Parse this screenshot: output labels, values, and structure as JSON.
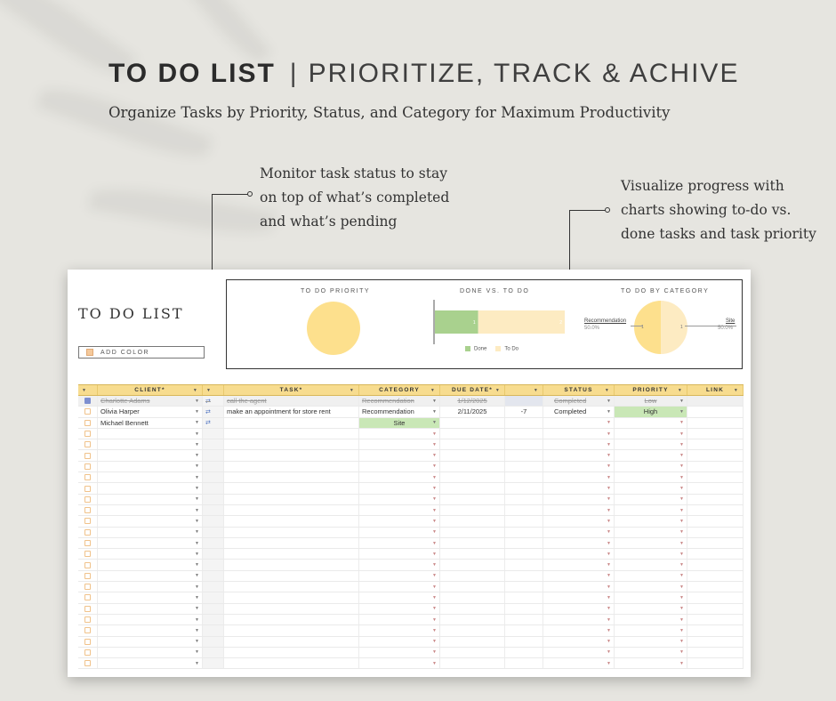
{
  "hero": {
    "title_strong": "TO DO LIST",
    "separator": "|",
    "title_rest": "PRIORITIZE, TRACK & ACHIVE",
    "subtitle": "Organize Tasks by Priority, Status, and Category for Maximum Productivity"
  },
  "callouts": {
    "status": [
      "Monitor task status to stay",
      "on top of what’s completed",
      "and what’s pending"
    ],
    "charts": [
      "Visualize progress with",
      "charts showing to-do vs.",
      "done tasks and task priority"
    ]
  },
  "sheet": {
    "title": "TO DO LIST",
    "add_color_label": "ADD COLOR",
    "charts": {
      "priority_title": "TO DO PRIORITY",
      "done_title": "DONE VS. TO DO",
      "category_title": "TO DO BY CATEGORY",
      "legend_done": "Done",
      "legend_todo": "To Do",
      "bar_done_label": "1",
      "bar_todo_label": "2",
      "cat_left_label": "Recommendation",
      "cat_left_pct": "50.0%",
      "cat_right_label": "Site",
      "cat_right_pct": "50.0%",
      "cat_left_count": "1",
      "cat_right_count": "1"
    },
    "colors": {
      "header": "#f7dc8f",
      "done_bar": "#a9d18e",
      "todo_bar": "#fdebc2",
      "pie": "#fde08d",
      "green_cell": "#c9e7b6"
    },
    "columns": [
      "CLIENT*",
      "TASK*",
      "CATEGORY",
      "DUE DATE*",
      "STATUS",
      "PRIORITY",
      "LINK"
    ],
    "rows": [
      {
        "done": true,
        "client": "Charlotte Adams",
        "task": "call the agent",
        "category": "Recommendation",
        "due": "1/12/2025",
        "days": "",
        "status": "Completed",
        "priority": "Low",
        "link": ""
      },
      {
        "done": false,
        "client": "Olivia Harper",
        "task": "make an appointment for store rent",
        "category": "Recommendation",
        "due": "2/11/2025",
        "days": "-7",
        "status": "Completed",
        "priority": "High",
        "link": ""
      },
      {
        "done": false,
        "client": "Michael Bennett",
        "task": "",
        "category": "Site",
        "due": "",
        "days": "",
        "status": "",
        "priority": "",
        "link": ""
      }
    ]
  },
  "chart_data": [
    {
      "type": "pie",
      "title": "TO DO PRIORITY",
      "categories": [
        ""
      ],
      "values": [
        1
      ]
    },
    {
      "type": "bar",
      "title": "DONE VS. TO DO",
      "categories": [
        "Done",
        "To Do"
      ],
      "values": [
        1,
        2
      ]
    },
    {
      "type": "pie",
      "title": "TO DO BY CATEGORY",
      "categories": [
        "Recommendation",
        "Site"
      ],
      "values": [
        1,
        1
      ],
      "percent_labels": [
        "50.0%",
        "50.0%"
      ]
    }
  ]
}
